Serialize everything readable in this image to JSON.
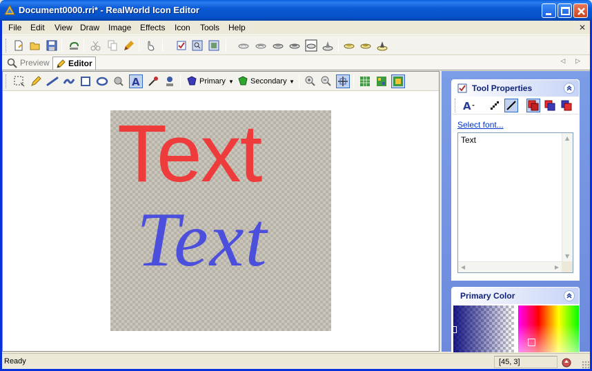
{
  "window": {
    "title": "Document0000.rri* - RealWorld Icon Editor"
  },
  "menu": {
    "items": [
      "File",
      "Edit",
      "View",
      "Draw",
      "Image",
      "Effects",
      "Icon",
      "Tools",
      "Help"
    ]
  },
  "tabs": {
    "preview": "Preview",
    "editor": "Editor",
    "active": "Editor"
  },
  "editor_toolbar": {
    "primary_label": "Primary",
    "secondary_label": "Secondary",
    "active_tool": "text-tool"
  },
  "canvas": {
    "text_red": "Text",
    "text_blue": "Text",
    "red_color": "#EE3B3B",
    "blue_color": "#4B4FDB"
  },
  "tool_properties": {
    "title": "Tool Properties",
    "select_font_link": "Select font...",
    "text_value": "Text"
  },
  "primary_color": {
    "title": "Primary Color"
  },
  "status": {
    "text": "Ready",
    "coords": "[45, 3]"
  }
}
